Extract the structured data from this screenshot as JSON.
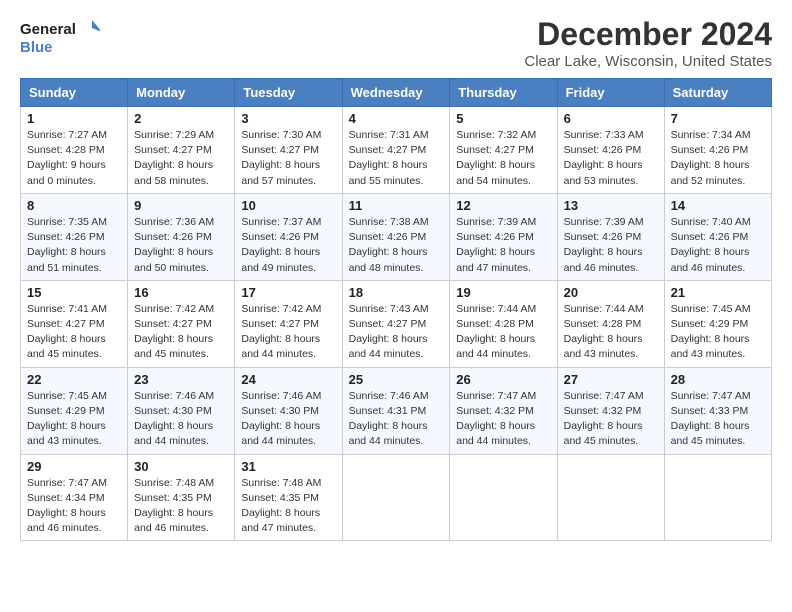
{
  "logo": {
    "line1": "General",
    "line2": "Blue"
  },
  "title": "December 2024",
  "subtitle": "Clear Lake, Wisconsin, United States",
  "weekdays": [
    "Sunday",
    "Monday",
    "Tuesday",
    "Wednesday",
    "Thursday",
    "Friday",
    "Saturday"
  ],
  "weeks": [
    [
      {
        "day": "1",
        "sunrise": "7:27 AM",
        "sunset": "4:28 PM",
        "daylight": "9 hours and 0 minutes."
      },
      {
        "day": "2",
        "sunrise": "7:29 AM",
        "sunset": "4:27 PM",
        "daylight": "8 hours and 58 minutes."
      },
      {
        "day": "3",
        "sunrise": "7:30 AM",
        "sunset": "4:27 PM",
        "daylight": "8 hours and 57 minutes."
      },
      {
        "day": "4",
        "sunrise": "7:31 AM",
        "sunset": "4:27 PM",
        "daylight": "8 hours and 55 minutes."
      },
      {
        "day": "5",
        "sunrise": "7:32 AM",
        "sunset": "4:27 PM",
        "daylight": "8 hours and 54 minutes."
      },
      {
        "day": "6",
        "sunrise": "7:33 AM",
        "sunset": "4:26 PM",
        "daylight": "8 hours and 53 minutes."
      },
      {
        "day": "7",
        "sunrise": "7:34 AM",
        "sunset": "4:26 PM",
        "daylight": "8 hours and 52 minutes."
      }
    ],
    [
      {
        "day": "8",
        "sunrise": "7:35 AM",
        "sunset": "4:26 PM",
        "daylight": "8 hours and 51 minutes."
      },
      {
        "day": "9",
        "sunrise": "7:36 AM",
        "sunset": "4:26 PM",
        "daylight": "8 hours and 50 minutes."
      },
      {
        "day": "10",
        "sunrise": "7:37 AM",
        "sunset": "4:26 PM",
        "daylight": "8 hours and 49 minutes."
      },
      {
        "day": "11",
        "sunrise": "7:38 AM",
        "sunset": "4:26 PM",
        "daylight": "8 hours and 48 minutes."
      },
      {
        "day": "12",
        "sunrise": "7:39 AM",
        "sunset": "4:26 PM",
        "daylight": "8 hours and 47 minutes."
      },
      {
        "day": "13",
        "sunrise": "7:39 AM",
        "sunset": "4:26 PM",
        "daylight": "8 hours and 46 minutes."
      },
      {
        "day": "14",
        "sunrise": "7:40 AM",
        "sunset": "4:26 PM",
        "daylight": "8 hours and 46 minutes."
      }
    ],
    [
      {
        "day": "15",
        "sunrise": "7:41 AM",
        "sunset": "4:27 PM",
        "daylight": "8 hours and 45 minutes."
      },
      {
        "day": "16",
        "sunrise": "7:42 AM",
        "sunset": "4:27 PM",
        "daylight": "8 hours and 45 minutes."
      },
      {
        "day": "17",
        "sunrise": "7:42 AM",
        "sunset": "4:27 PM",
        "daylight": "8 hours and 44 minutes."
      },
      {
        "day": "18",
        "sunrise": "7:43 AM",
        "sunset": "4:27 PM",
        "daylight": "8 hours and 44 minutes."
      },
      {
        "day": "19",
        "sunrise": "7:44 AM",
        "sunset": "4:28 PM",
        "daylight": "8 hours and 44 minutes."
      },
      {
        "day": "20",
        "sunrise": "7:44 AM",
        "sunset": "4:28 PM",
        "daylight": "8 hours and 43 minutes."
      },
      {
        "day": "21",
        "sunrise": "7:45 AM",
        "sunset": "4:29 PM",
        "daylight": "8 hours and 43 minutes."
      }
    ],
    [
      {
        "day": "22",
        "sunrise": "7:45 AM",
        "sunset": "4:29 PM",
        "daylight": "8 hours and 43 minutes."
      },
      {
        "day": "23",
        "sunrise": "7:46 AM",
        "sunset": "4:30 PM",
        "daylight": "8 hours and 44 minutes."
      },
      {
        "day": "24",
        "sunrise": "7:46 AM",
        "sunset": "4:30 PM",
        "daylight": "8 hours and 44 minutes."
      },
      {
        "day": "25",
        "sunrise": "7:46 AM",
        "sunset": "4:31 PM",
        "daylight": "8 hours and 44 minutes."
      },
      {
        "day": "26",
        "sunrise": "7:47 AM",
        "sunset": "4:32 PM",
        "daylight": "8 hours and 44 minutes."
      },
      {
        "day": "27",
        "sunrise": "7:47 AM",
        "sunset": "4:32 PM",
        "daylight": "8 hours and 45 minutes."
      },
      {
        "day": "28",
        "sunrise": "7:47 AM",
        "sunset": "4:33 PM",
        "daylight": "8 hours and 45 minutes."
      }
    ],
    [
      {
        "day": "29",
        "sunrise": "7:47 AM",
        "sunset": "4:34 PM",
        "daylight": "8 hours and 46 minutes."
      },
      {
        "day": "30",
        "sunrise": "7:48 AM",
        "sunset": "4:35 PM",
        "daylight": "8 hours and 46 minutes."
      },
      {
        "day": "31",
        "sunrise": "7:48 AM",
        "sunset": "4:35 PM",
        "daylight": "8 hours and 47 minutes."
      },
      null,
      null,
      null,
      null
    ]
  ],
  "labels": {
    "sunrise": "Sunrise:",
    "sunset": "Sunset:",
    "daylight": "Daylight:"
  }
}
